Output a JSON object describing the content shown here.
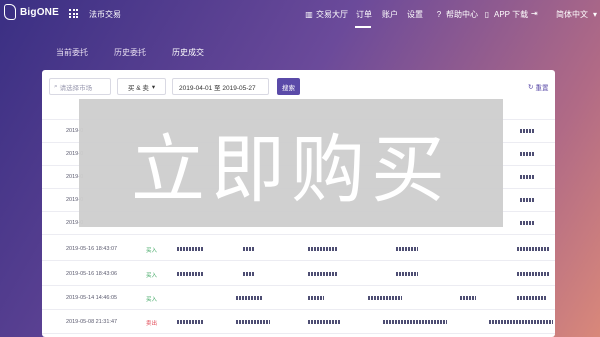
{
  "brand": {
    "name": "BigONE"
  },
  "nav": {
    "fiat": "法币交易",
    "trading_hall": "交易大厅",
    "orders": "订单",
    "account": "账户",
    "settings": "设置",
    "help": "帮助中心",
    "app": "APP 下载",
    "language": "简体中文"
  },
  "tabs": [
    "当前委托",
    "历史委托",
    "历史成交"
  ],
  "filters": {
    "market_placeholder": "请选择市场",
    "side": "买 & 卖",
    "date_range": "2019-04-01 至 2019-05-27",
    "search": "搜索",
    "reset": "重置"
  },
  "rows": [
    {
      "time": "2019-0",
      "side": ""
    },
    {
      "time": "2019-0",
      "side": ""
    },
    {
      "time": "2019-0",
      "side": ""
    },
    {
      "time": "2019-0",
      "side": ""
    },
    {
      "time": "2019-0",
      "side": ""
    },
    {
      "time": "2019-05-16 18:43:07",
      "side": "买入",
      "type": "buy"
    },
    {
      "time": "2019-05-16 18:43:06",
      "side": "买入",
      "type": "buy"
    },
    {
      "time": "2019-05-14 14:46:05",
      "side": "买入",
      "type": "buy"
    },
    {
      "time": "2019-05-08 21:31:47",
      "side": "卖出",
      "type": "sell"
    }
  ],
  "watermark": "立即购买",
  "colors": {
    "accent": "#5a4aa8",
    "buy": "#33a159",
    "sell": "#e0424f"
  }
}
